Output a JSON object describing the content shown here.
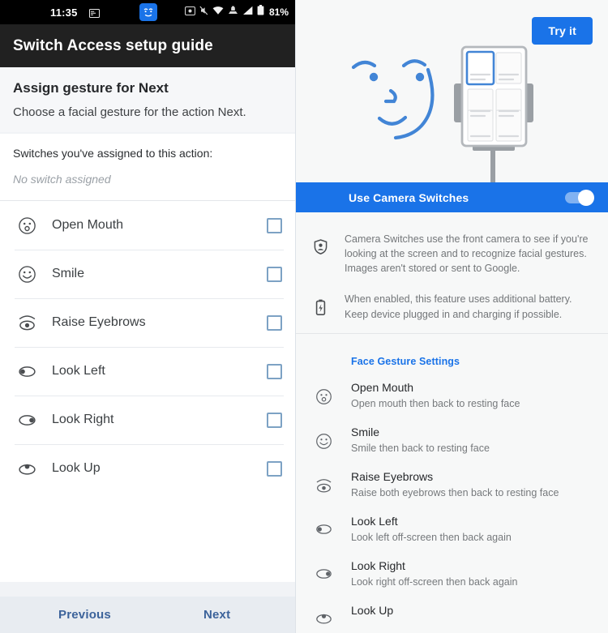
{
  "left_panel": {
    "statusbar": {
      "time": "11:35",
      "battery_percent": "81%",
      "icons": [
        "message-icon",
        "camera-switches-face-icon",
        "screenshot-icon",
        "mute-icon",
        "wifi-icon",
        "vpn-icon",
        "signal-icon",
        "battery-icon"
      ]
    },
    "appbar": {
      "title": "Switch Access setup guide"
    },
    "assign": {
      "title": "Assign gesture for Next",
      "subtitle": "Choose a facial gesture for the action Next."
    },
    "assigned": {
      "label": "Switches you've assigned to this action:",
      "value": "No switch assigned"
    },
    "gestures": [
      {
        "icon": "open-mouth-face-icon",
        "label": "Open Mouth",
        "checked": false
      },
      {
        "icon": "smile-face-icon",
        "label": "Smile",
        "checked": false
      },
      {
        "icon": "raise-eyebrows-eye-icon",
        "label": "Raise Eyebrows",
        "checked": false
      },
      {
        "icon": "look-left-eye-icon",
        "label": "Look Left",
        "checked": false
      },
      {
        "icon": "look-right-eye-icon",
        "label": "Look Right",
        "checked": false
      },
      {
        "icon": "look-up-eye-icon",
        "label": "Look Up",
        "checked": false
      }
    ],
    "bottom_nav": {
      "previous": "Previous",
      "next": "Next"
    }
  },
  "right_panel": {
    "hero": {
      "try_button": "Try it",
      "illustration": "face-and-phone-on-stand-illustration"
    },
    "toggle": {
      "label": "Use Camera Switches",
      "state": "on"
    },
    "info_rows": [
      {
        "icon": "privacy-shield-icon",
        "text": "Camera Switches use the front camera to see if you're looking at the screen and to recognize facial gestures. Images aren't stored or sent to Google."
      },
      {
        "icon": "battery-charging-icon",
        "text": "When enabled, this feature uses additional battery. Keep device plugged in and charging if possible."
      }
    ],
    "section_header": "Face Gesture Settings",
    "face_gestures": [
      {
        "icon": "open-mouth-face-icon",
        "title": "Open Mouth",
        "desc": "Open mouth then back to resting face"
      },
      {
        "icon": "smile-face-icon",
        "title": "Smile",
        "desc": "Smile then back to resting face"
      },
      {
        "icon": "raise-eyebrows-eye-icon",
        "title": "Raise Eyebrows",
        "desc": "Raise both eyebrows then back to resting face"
      },
      {
        "icon": "look-left-eye-icon",
        "title": "Look Left",
        "desc": "Look left off-screen then back again"
      },
      {
        "icon": "look-right-eye-icon",
        "title": "Look Right",
        "desc": "Look right off-screen then back again"
      },
      {
        "icon": "look-up-eye-icon",
        "title": "Look Up",
        "desc": ""
      }
    ]
  },
  "colors": {
    "accent_blue": "#1a73e8",
    "appbar_dark": "#212121",
    "statusbar_black": "#000000",
    "nav_link_blue": "#3c639b",
    "checkbox_border": "#7da2c4",
    "panel_bg": "#f7f8f8"
  }
}
